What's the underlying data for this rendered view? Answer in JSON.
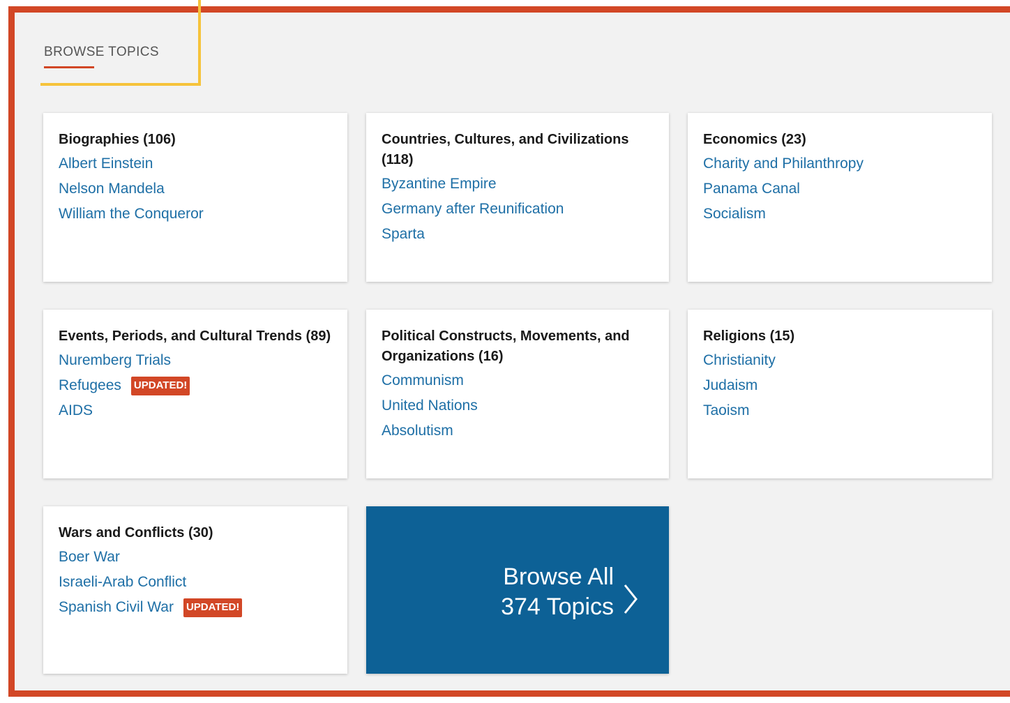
{
  "section": {
    "heading": "BROWSE TOPICS"
  },
  "cards": [
    {
      "title": "Biographies",
      "count": "(106)",
      "topics": [
        {
          "label": "Albert Einstein",
          "badge": ""
        },
        {
          "label": "Nelson Mandela",
          "badge": ""
        },
        {
          "label": "William the Conqueror",
          "badge": ""
        }
      ]
    },
    {
      "title": "Countries, Cultures, and Civilizations",
      "count": "(118)",
      "topics": [
        {
          "label": "Byzantine Empire",
          "badge": ""
        },
        {
          "label": "Germany after Reunification",
          "badge": ""
        },
        {
          "label": "Sparta",
          "badge": ""
        }
      ]
    },
    {
      "title": "Economics",
      "count": "(23)",
      "topics": [
        {
          "label": "Charity and Philanthropy",
          "badge": ""
        },
        {
          "label": "Panama Canal",
          "badge": ""
        },
        {
          "label": "Socialism",
          "badge": ""
        }
      ]
    },
    {
      "title": "Events, Periods, and Cultural Trends",
      "count": "(89)",
      "topics": [
        {
          "label": "Nuremberg Trials",
          "badge": ""
        },
        {
          "label": "Refugees",
          "badge": "UPDATED!"
        },
        {
          "label": "AIDS",
          "badge": ""
        }
      ]
    },
    {
      "title": "Political Constructs, Movements, and Organizations",
      "count": "(16)",
      "topics": [
        {
          "label": "Communism",
          "badge": ""
        },
        {
          "label": "United Nations",
          "badge": ""
        },
        {
          "label": "Absolutism",
          "badge": ""
        }
      ]
    },
    {
      "title": "Religions",
      "count": "(15)",
      "topics": [
        {
          "label": "Christianity",
          "badge": ""
        },
        {
          "label": "Judaism",
          "badge": ""
        },
        {
          "label": "Taoism",
          "badge": ""
        }
      ]
    },
    {
      "title": "Wars and Conflicts",
      "count": "(30)",
      "topics": [
        {
          "label": "Boer War",
          "badge": ""
        },
        {
          "label": "Israeli-Arab Conflict",
          "badge": ""
        },
        {
          "label": "Spanish Civil War",
          "badge": "UPDATED!"
        }
      ]
    }
  ],
  "browse_all": {
    "line1": "Browse All",
    "line2": "374 Topics",
    "icon": "chevron-right-icon"
  },
  "colors": {
    "accent": "#d24726",
    "focus": "#f6c33b",
    "link": "#1e6fa6",
    "browse_bg": "#0d6196",
    "page_bg": "#f2f2f2"
  }
}
